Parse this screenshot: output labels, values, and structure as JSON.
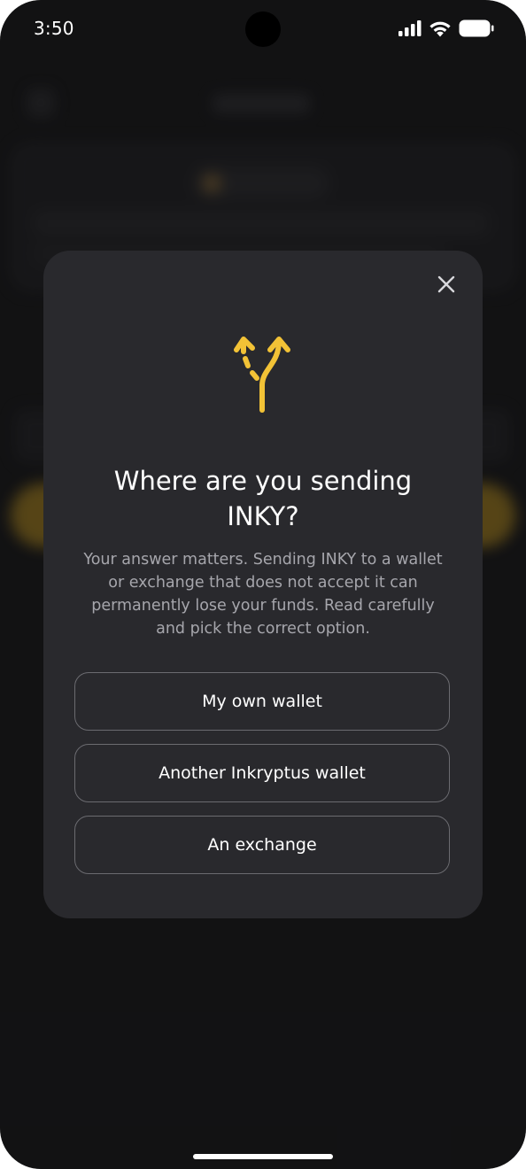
{
  "status_bar": {
    "time": "3:50",
    "signal_icon": "cellular-signal-icon",
    "wifi_icon": "wifi-icon",
    "battery_icon": "battery-icon"
  },
  "modal": {
    "close_icon": "close-icon",
    "hero_icon": "split-arrows-icon",
    "title": "Where are you sending INKY?",
    "description": "Your answer matters. Sending INKY to a wallet or exchange that does not accept it can permanently lose your funds. Read carefully and pick the correct option.",
    "options": [
      {
        "label": "My own wallet"
      },
      {
        "label": "Another Inkryptus wallet"
      },
      {
        "label": "An exchange"
      }
    ]
  },
  "colors": {
    "accent": "#f2c236",
    "modal_bg": "#29292d",
    "screen_bg": "#1c1c1e",
    "option_border": "#6b6b70"
  }
}
